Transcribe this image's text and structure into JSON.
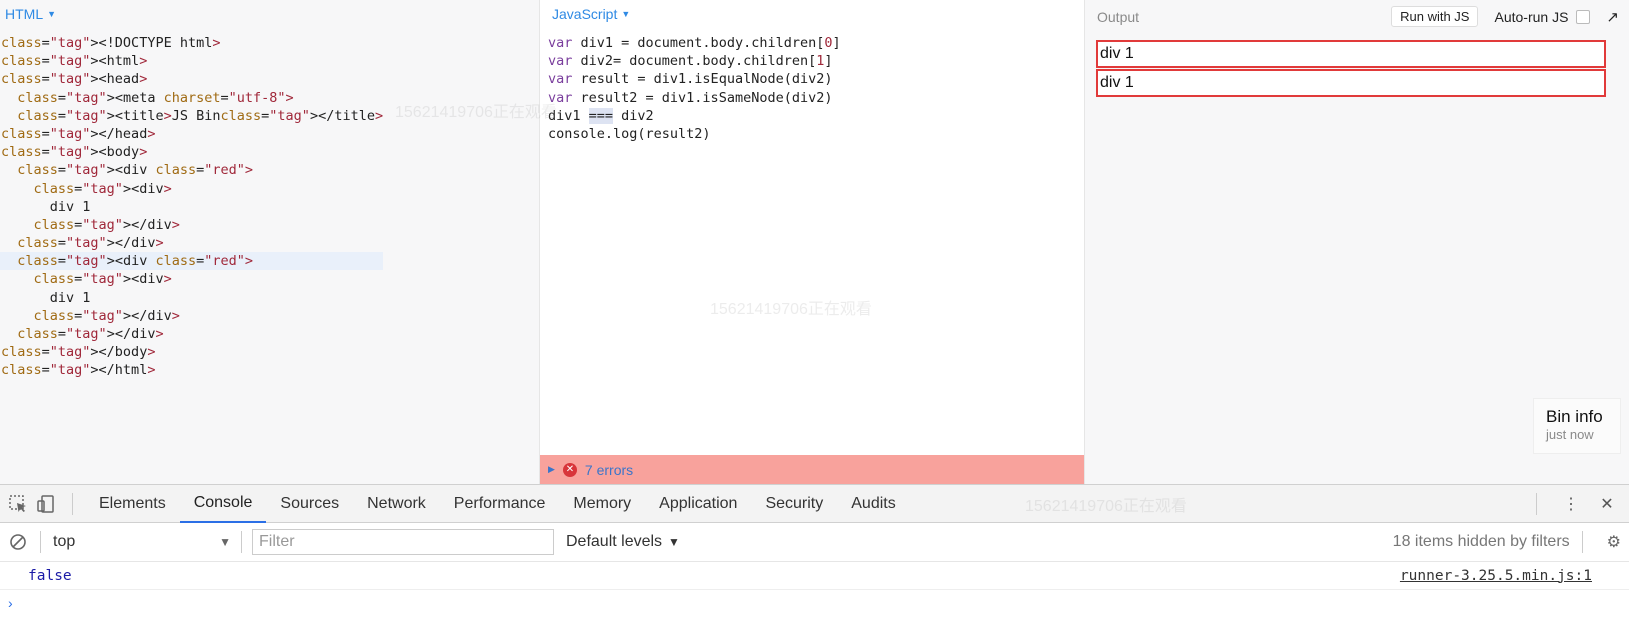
{
  "html_pane": {
    "label": "HTML",
    "lines": [
      "<!DOCTYPE html>",
      "<html>",
      "<head>",
      "  <meta charset=\"utf-8\">",
      "  <title>JS Bin</title>",
      "</head>",
      "<body>",
      "  <div class=\"red\">",
      "    <div>",
      "      div 1",
      "    </div>",
      "  </div>",
      "  <div class=\"red\">",
      "    <div>",
      "      div 1",
      "    </div>",
      "  </div>",
      "</body>",
      "</html>"
    ],
    "highlighted_line": 12
  },
  "js_pane": {
    "label": "JavaScript",
    "lines": [
      "var div1 = document.body.children[0]",
      "var div2= document.body.children[1]",
      "var result = div1.isEqualNode(div2)",
      "var result2 = div1.isSameNode(div2)",
      "div1 === div2",
      "console.log(result2)"
    ],
    "errors_label": "7 errors"
  },
  "output_pane": {
    "label": "Output",
    "run_button": "Run with JS",
    "autorun_label": "Auto-run JS",
    "divs": [
      "div 1",
      "div 1"
    ],
    "bin_info_title": "Bin info",
    "bin_info_sub": "just now"
  },
  "devtools": {
    "tabs": [
      "Elements",
      "Console",
      "Sources",
      "Network",
      "Performance",
      "Memory",
      "Application",
      "Security",
      "Audits"
    ],
    "active_tab": "Console",
    "context": "top",
    "filter_placeholder": "Filter",
    "levels": "Default levels",
    "hidden_count": "18 items hidden by filters",
    "console_output": "false",
    "console_source": "runner-3.25.5.min.js:1"
  },
  "watermark": "15621419706正在观看"
}
